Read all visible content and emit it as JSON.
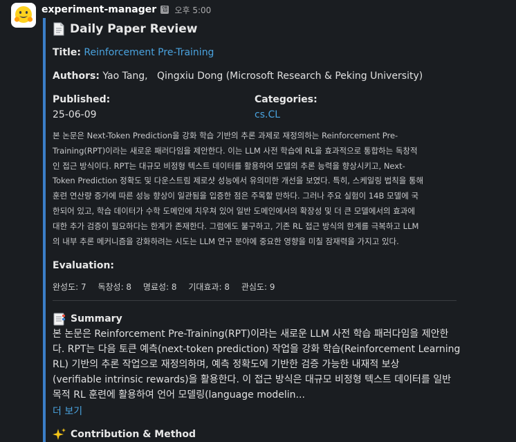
{
  "message": {
    "bot_name": "experiment-manager",
    "app_badge": "앱",
    "time": "오후 5:00"
  },
  "card": {
    "title": "Daily Paper Review",
    "title_label": "Title:",
    "paper_title": "Reinforcement Pre-Training",
    "authors_label": "Authors:",
    "authors": "Yao Tang,   Qingxiu Dong (Microsoft Research & Peking University)",
    "published_label": "Published:",
    "published": "25-06-09",
    "categories_label": "Categories:",
    "categories": "cs.CL",
    "abstract_lines": [
      "본 논문은 Next-Token Prediction을 강화 학습 기반의 추론 과제로 재정의하는 Reinforcement Pre-",
      "Training(RPT)이라는 새로운 패러다임을 제안한다. 이는 LLM 사전 학습에 RL을 효과적으로 통합하는 독창적",
      "인 접근 방식이다. RPT는 대규모 비정형 텍스트 데이터를 활용하여 모델의 추론 능력을 향상시키고, Next-",
      "Token Prediction 정확도 및 다운스트림 제로샷 성능에서 유의미한 개선을 보였다. 특히, 스케일링 법칙을 통해",
      "훈련 연산량 증가에 따른 성능 향상이 일관됨을 입증한 점은 주목할 만하다. 그러나 주요 실험이 14B 모델에 국",
      "한되어 있고, 학습 데이터가 수학 도메인에 치우쳐 있어 일반 도메인에서의 확장성 및 더 큰 모델에서의 효과에",
      "대한 추가 검증이 필요하다는 한계가 존재한다. 그럼에도 불구하고, 기존 RL 접근 방식의 한계를 극복하고 LLM",
      "의 내부 추론 메커니즘을 강화하려는 시도는 LLM 연구 분야에 중요한 영향을 미칠 잠재력을 가지고 있다."
    ],
    "evaluation_label": "Evaluation:",
    "metrics": [
      "완성도: 7",
      "독창성: 8",
      "명료성: 8",
      "기대효과: 8",
      "관심도: 9"
    ],
    "summary_heading": "Summary",
    "summary_lines": [
      "본 논문은 Reinforcement Pre-Training(RPT)이라는 새로운 LLM 사전 학습 패러다임을 제안한",
      "다. RPT는 다음 토큰 예측(next-token prediction) 작업을 강화 학습(Reinforcement Learning,",
      "RL) 기반의 추론 작업으로 재정의하며, 예측 정확도에 기반한 검증 가능한 내재적 보상",
      "(verifiable intrinsic rewards)을 활용한다. 이 접근 방식은 대규모 비정형 텍스트 데이터를 일반",
      "목적 RL 훈련에 활용하여 언어 모델링(language modelin..."
    ],
    "more_label": "더 보기",
    "contribution_heading": "Contribution & Method"
  },
  "icons": {
    "avatar": "hugging-face-icon",
    "title": "page-icon",
    "summary": "bookmark-tabs-icon",
    "contribution": "sparkles-icon"
  },
  "colors": {
    "background": "#1a1d21",
    "accent_bar": "#3b7ec8",
    "link": "#4aa3df"
  }
}
